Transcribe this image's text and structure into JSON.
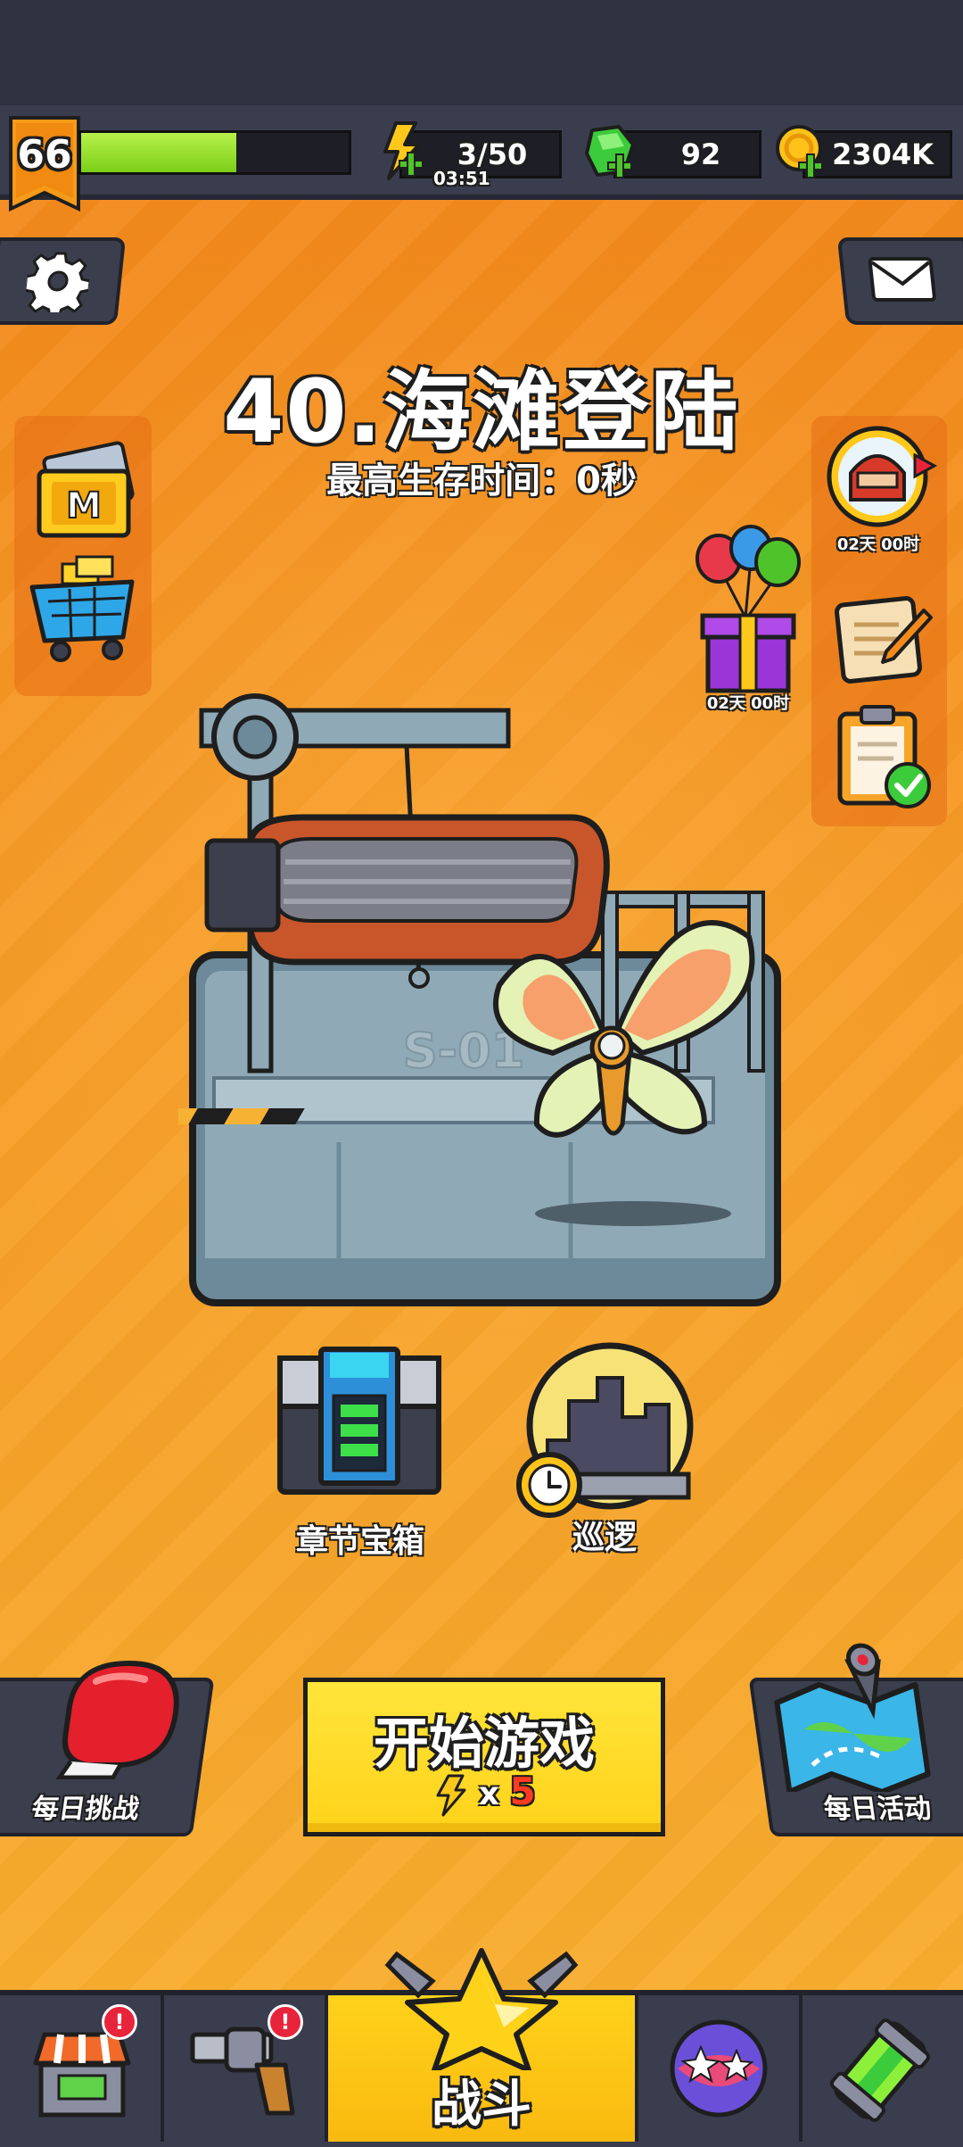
{
  "hud": {
    "level": "66",
    "xp_progress": 0.58,
    "energy": "3/50",
    "energy_timer": "03:51",
    "gems": "92",
    "coins": "2304K"
  },
  "stage": {
    "title": "40.海滩登陆",
    "best_survival": "最高生存时间：0秒",
    "ship_code": "S-01"
  },
  "right_panel": {
    "hero_timer": "02天 00时",
    "gift_timer": "02天 00时"
  },
  "chapter": {
    "chest_label": "章节宝箱",
    "patrol_label": "巡逻"
  },
  "actions": {
    "daily_challenge": "每日挑战",
    "start_game": "开始游戏",
    "start_cost_x": "x",
    "start_cost": "5",
    "daily_event": "每日活动"
  },
  "nav": {
    "battle": "战斗",
    "shop_badge": "!",
    "weapon_badge": "!"
  },
  "colors": {
    "background": "#f38d1e",
    "start_button": "#ffd21a",
    "xp": "#9be430",
    "gem": "#3ccb3a",
    "coin": "#ffc21a"
  }
}
